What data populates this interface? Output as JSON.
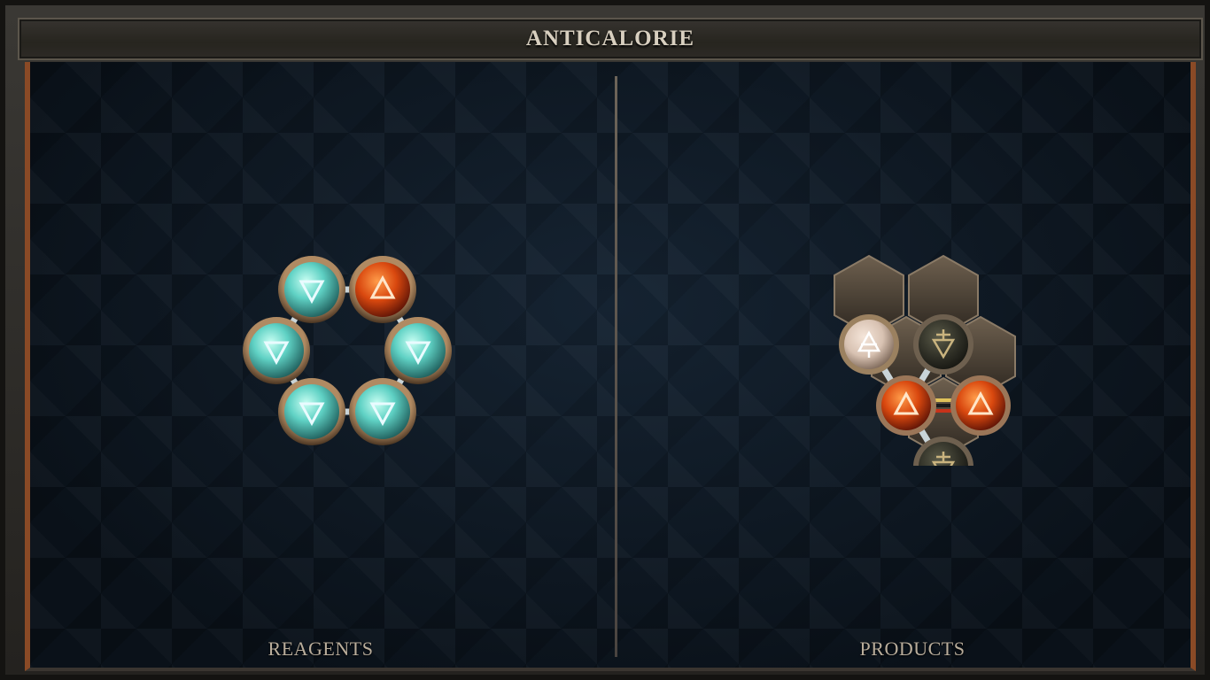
{
  "title": "ANTICALORIE",
  "panels": {
    "reagents_label": "REAGENTS",
    "products_label": "PRODUCTS"
  },
  "reagent_molecule": {
    "atoms": [
      {
        "id": "r1",
        "element": "water",
        "symbol": "water-triangle-down-icon"
      },
      {
        "id": "r2",
        "element": "fire",
        "symbol": "fire-triangle-up-icon"
      },
      {
        "id": "r3",
        "element": "water",
        "symbol": "water-triangle-down-icon"
      },
      {
        "id": "r4",
        "element": "water",
        "symbol": "water-triangle-down-icon"
      },
      {
        "id": "r5",
        "element": "water",
        "symbol": "water-triangle-down-icon"
      },
      {
        "id": "r6",
        "element": "water",
        "symbol": "water-triangle-down-icon"
      }
    ],
    "bonds": [
      [
        "r1",
        "r2"
      ],
      [
        "r2",
        "r4"
      ],
      [
        "r4",
        "r6"
      ],
      [
        "r6",
        "r5"
      ],
      [
        "r5",
        "r3"
      ],
      [
        "r3",
        "r1"
      ]
    ]
  },
  "product_molecule": {
    "atoms": [
      {
        "id": "p1",
        "element": "air",
        "symbol": "air-triangle-up-barred-icon"
      },
      {
        "id": "p2",
        "element": "earth",
        "symbol": "earth-triangle-down-barred-icon"
      },
      {
        "id": "p3",
        "element": "fire",
        "symbol": "fire-triangle-up-icon"
      },
      {
        "id": "p4",
        "element": "fire",
        "symbol": "fire-triangle-up-icon"
      },
      {
        "id": "p5",
        "element": "earth",
        "symbol": "earth-triangle-down-barred-icon"
      }
    ],
    "bonds": [
      [
        "p1",
        "p3"
      ],
      [
        "p2",
        "p3"
      ],
      [
        "p3",
        "p4"
      ],
      [
        "p3",
        "p5"
      ]
    ],
    "triplex_bond": [
      "p3",
      "p4"
    ]
  },
  "colors": {
    "water": "#5fd1c4",
    "fire": "#d9480f",
    "air": "#d8c2b2",
    "earth": "#3a3a2e",
    "bronze": "#8a6a48",
    "frame_accent": "#8a4a26"
  }
}
